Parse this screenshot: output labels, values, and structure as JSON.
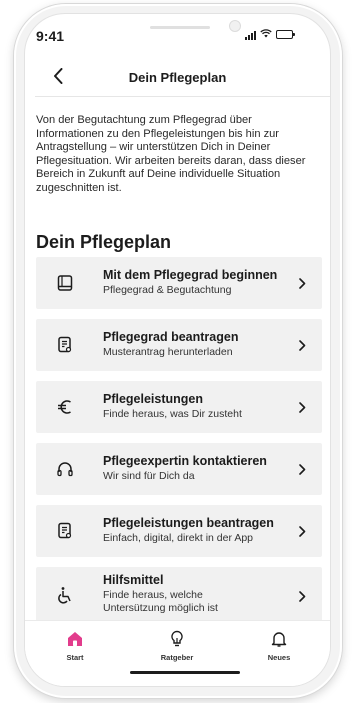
{
  "status_bar": {
    "time": "9:41"
  },
  "header": {
    "title": "Dein Pflegeplan"
  },
  "intro_text": "Von der Begutachtung zum Pflegegrad über Informationen zu den Pflegeleistungen bis hin zur Antragstellung – wir unterstützen Dich in Deiner Pflegesituation. Wir arbeiten bereits daran, dass dieser Bereich in Zukunft auf Deine individuelle Situation zugeschnitten ist.",
  "section_title": "Dein Pflegeplan",
  "cards": [
    {
      "title": "Mit dem Pflegegrad beginnen",
      "subtitle": "Pflegegrad & Begutachtung",
      "icon": "book-icon"
    },
    {
      "title": "Pflegegrad beantragen",
      "subtitle": "Musterantrag herunterladen",
      "icon": "document-icon"
    },
    {
      "title": "Pflegeleistungen",
      "subtitle": "Finde heraus, was Dir zusteht",
      "icon": "euro-icon"
    },
    {
      "title": "Pflegeexpertin kontaktieren",
      "subtitle": "Wir sind für Dich da",
      "icon": "headphones-icon"
    },
    {
      "title": "Pflegeleistungen beantragen",
      "subtitle": "Einfach, digital, direkt in der App",
      "icon": "document-icon"
    },
    {
      "title": "Hilfsmittel",
      "subtitle": "Finde heraus, welche Untersützung möglich ist",
      "icon": "wheelchair-icon"
    }
  ],
  "tabs": [
    {
      "label": "Start",
      "icon": "home-icon",
      "active": true
    },
    {
      "label": "Ratgeber",
      "icon": "lightbulb-icon",
      "active": false
    },
    {
      "label": "Neues",
      "icon": "bell-icon",
      "active": false
    }
  ],
  "colors": {
    "accent": "#e23c8c",
    "card_bg": "#f1f1f1",
    "text": "#1c1c1c"
  }
}
